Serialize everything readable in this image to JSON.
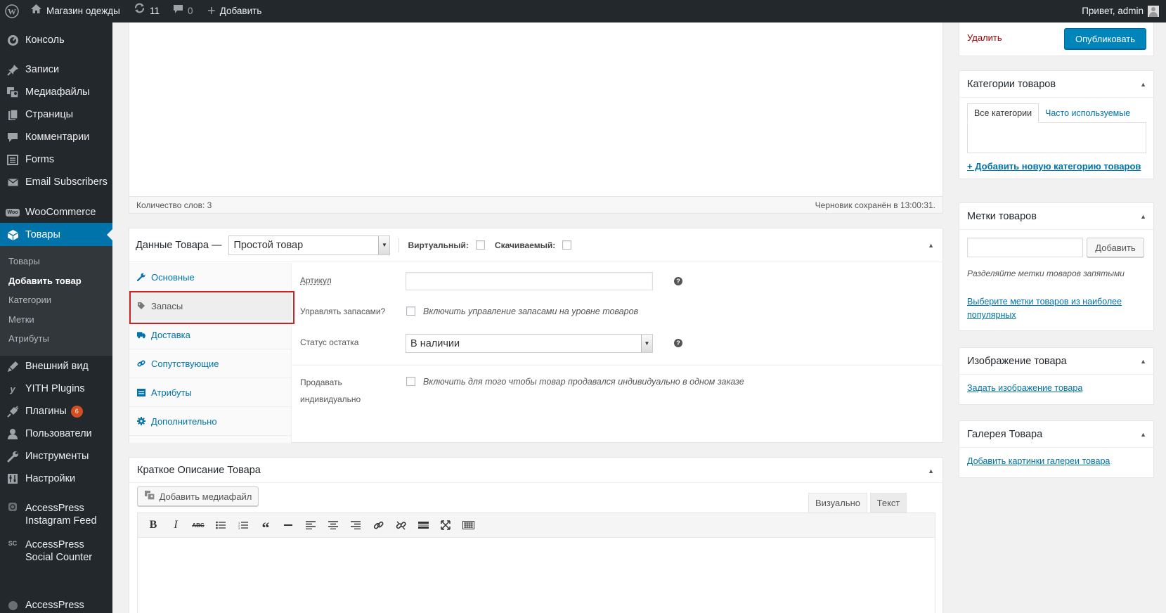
{
  "adminbar": {
    "site_name": "Магазин одежды",
    "updates_count": "11",
    "comments_count": "0",
    "add_label": "Добавить",
    "greeting": "Привет, admin"
  },
  "sidebar": {
    "items": [
      {
        "label": "Консоль",
        "icon": "dashboard-icon"
      },
      {
        "label": "Записи",
        "icon": "pin-icon"
      },
      {
        "label": "Медиафайлы",
        "icon": "media-icon"
      },
      {
        "label": "Страницы",
        "icon": "pages-icon"
      },
      {
        "label": "Комментарии",
        "icon": "comments-icon"
      },
      {
        "label": "Forms",
        "icon": "forms-icon"
      },
      {
        "label": "Email Subscribers",
        "icon": "email-icon"
      },
      {
        "label": "WooCommerce",
        "icon": "woo-icon"
      },
      {
        "label": "Товары",
        "icon": "products-icon"
      },
      {
        "label": "Внешний вид",
        "icon": "appearance-icon"
      },
      {
        "label": "YITH Plugins",
        "icon": "yith-icon"
      },
      {
        "label": "Плагины",
        "icon": "plugins-icon",
        "badge": "6"
      },
      {
        "label": "Пользователи",
        "icon": "users-icon"
      },
      {
        "label": "Инструменты",
        "icon": "tools-icon"
      },
      {
        "label": "Настройки",
        "icon": "settings-icon"
      },
      {
        "label": "AccessPress Instagram Feed",
        "icon": "instagram-icon"
      },
      {
        "label": "AccessPress Social Counter",
        "icon": "social-counter-icon"
      },
      {
        "label": "AccessPress",
        "icon": "accesspress-icon"
      }
    ],
    "submenu": [
      "Товары",
      "Добавить товар",
      "Категории",
      "Метки",
      "Атрибуты"
    ]
  },
  "editor": {
    "word_count": "Количество слов: 3",
    "draft_saved": "Черновик сохранён в 13:00:31."
  },
  "product_data": {
    "title": "Данные Товара —",
    "type_value": "Простой товар",
    "virtual_label": "Виртуальный:",
    "downloadable_label": "Скачиваемый:",
    "tabs": [
      {
        "label": "Основные",
        "icon": "wrench-icon"
      },
      {
        "label": "Запасы",
        "icon": "tag-icon"
      },
      {
        "label": "Доставка",
        "icon": "truck-icon"
      },
      {
        "label": "Сопутствующие",
        "icon": "link-icon"
      },
      {
        "label": "Атрибуты",
        "icon": "list-icon"
      },
      {
        "label": "Дополнительно",
        "icon": "gear-icon"
      }
    ],
    "sku_label": "Артикул",
    "sku_value": "",
    "manage_stock_label": "Управлять запасами?",
    "manage_stock_desc": "Включить управление запасами на уровне товаров",
    "stock_status_label": "Статус остатка",
    "stock_status_value": "В наличии",
    "sold_individually_label_1": "Продавать",
    "sold_individually_label_2": "индивидуально",
    "sold_individually_desc": "Включить для того чтобы товар продавался индивидуально в одном заказе"
  },
  "short_desc": {
    "title": "Краткое Описание Товара",
    "add_media": "Добавить медиафайл",
    "tab_visual": "Визуально",
    "tab_text": "Текст"
  },
  "publish": {
    "delete_label": "Удалить",
    "publish_label": "Опубликовать"
  },
  "categories": {
    "title": "Категории товаров",
    "tab_all": "Все категории",
    "tab_popular": "Часто используемые",
    "add_new": "+ Добавить новую категорию товаров"
  },
  "tags": {
    "title": "Метки товаров",
    "input_value": "",
    "add_button": "Добавить",
    "hint": "Разделяйте метки товаров запятыми",
    "choose_popular_1": "Выберите метки товаров из наиболее",
    "choose_popular_2": "популярных"
  },
  "image": {
    "title": "Изображение товара",
    "set_link": "Задать изображение товара"
  },
  "gallery": {
    "title": "Галерея Товара",
    "add_link": "Добавить картинки галереи товара"
  },
  "colors": {
    "adminbar_bg": "#23282d",
    "accent": "#0073aa",
    "highlight_border": "#d21f1f",
    "delete": "#a00",
    "badge": "#d54e21"
  }
}
